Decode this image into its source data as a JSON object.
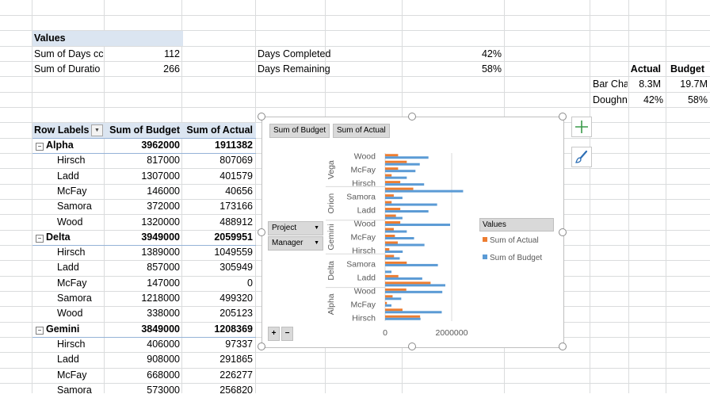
{
  "values_table": {
    "header": "Values",
    "rows": [
      {
        "label": "Sum of Days cc",
        "value": "112"
      },
      {
        "label": "Sum of Duratio",
        "value": "266"
      }
    ]
  },
  "days_table": {
    "rows": [
      {
        "label": "Days Completed",
        "value": "42%"
      },
      {
        "label": "Days Remaining",
        "value": "58%"
      }
    ]
  },
  "summary_table": {
    "headers": [
      "Actual",
      "Budget"
    ],
    "rows": [
      {
        "label": "Bar Cha",
        "actual": "8.3M",
        "budget": "19.7M"
      },
      {
        "label": "Doughn",
        "actual": "42%",
        "budget": "58%"
      }
    ]
  },
  "pivot": {
    "headers": {
      "row_labels": "Row Labels",
      "budget": "Sum of Budget",
      "actual": "Sum of Actual"
    },
    "rows": [
      {
        "type": "group",
        "label": "Alpha",
        "budget": "3962000",
        "actual": "1911382"
      },
      {
        "type": "item",
        "label": "Hirsch",
        "budget": "817000",
        "actual": "807069"
      },
      {
        "type": "item",
        "label": "Ladd",
        "budget": "1307000",
        "actual": "401579"
      },
      {
        "type": "item",
        "label": "McFay",
        "budget": "146000",
        "actual": "40656"
      },
      {
        "type": "item",
        "label": "Samora",
        "budget": "372000",
        "actual": "173166"
      },
      {
        "type": "item",
        "label": "Wood",
        "budget": "1320000",
        "actual": "488912"
      },
      {
        "type": "group",
        "label": "Delta",
        "budget": "3949000",
        "actual": "2059951"
      },
      {
        "type": "item",
        "label": "Hirsch",
        "budget": "1389000",
        "actual": "1049559"
      },
      {
        "type": "item",
        "label": "Ladd",
        "budget": "857000",
        "actual": "305949"
      },
      {
        "type": "item",
        "label": "McFay",
        "budget": "147000",
        "actual": "0"
      },
      {
        "type": "item",
        "label": "Samora",
        "budget": "1218000",
        "actual": "499320"
      },
      {
        "type": "item",
        "label": "Wood",
        "budget": "338000",
        "actual": "205123"
      },
      {
        "type": "group",
        "label": "Gemini",
        "budget": "3849000",
        "actual": "1208369"
      },
      {
        "type": "item",
        "label": "Hirsch",
        "budget": "406000",
        "actual": "97337"
      },
      {
        "type": "item",
        "label": "Ladd",
        "budget": "908000",
        "actual": "291865"
      },
      {
        "type": "item",
        "label": "McFay",
        "budget": "668000",
        "actual": "226277"
      },
      {
        "type": "item",
        "label": "Samora",
        "budget": "573000",
        "actual": "256820"
      }
    ]
  },
  "chart_ui": {
    "field_buttons": [
      "Sum of Budget",
      "Sum of Actual"
    ],
    "axis_buttons": [
      "Project",
      "Manager"
    ],
    "legend_title": "Values",
    "plus_label": "+",
    "minus_label": "−",
    "icons": {
      "add": "plus-icon",
      "style": "brush-icon"
    }
  },
  "chart_data": {
    "type": "bar",
    "orientation": "horizontal",
    "groups": [
      {
        "name": "Vega",
        "categories": [
          {
            "name": "Wood",
            "budget": 1000000,
            "actual": 300000
          },
          {
            "name": "",
            "budget": 800000,
            "actual": 500000
          },
          {
            "name": "McFay",
            "budget": 700000,
            "actual": 300000
          },
          {
            "name": "",
            "budget": 500000,
            "actual": 150000
          },
          {
            "name": "Hirsch",
            "budget": 900000,
            "actual": 350000
          }
        ]
      },
      {
        "name": "Orion",
        "categories": [
          {
            "name": "",
            "budget": 1800000,
            "actual": 650000
          },
          {
            "name": "Samora",
            "budget": 400000,
            "actual": 200000
          },
          {
            "name": "",
            "budget": 1200000,
            "actual": 150000
          },
          {
            "name": "Ladd",
            "budget": 1000000,
            "actual": 350000
          },
          {
            "name": "",
            "budget": 400000,
            "actual": 250000
          }
        ]
      },
      {
        "name": "Gemini",
        "categories": [
          {
            "name": "Wood",
            "budget": 1500000,
            "actual": 350000
          },
          {
            "name": "",
            "budget": 500000,
            "actual": 200000
          },
          {
            "name": "McFay",
            "budget": 668000,
            "actual": 226277
          },
          {
            "name": "",
            "budget": 908000,
            "actual": 291865
          },
          {
            "name": "Hirsch",
            "budget": 406000,
            "actual": 97337
          }
        ]
      },
      {
        "name": "Delta",
        "categories": [
          {
            "name": "",
            "budget": 338000,
            "actual": 205123
          },
          {
            "name": "Samora",
            "budget": 1218000,
            "actual": 499320
          },
          {
            "name": "",
            "budget": 147000,
            "actual": 0
          },
          {
            "name": "Ladd",
            "budget": 857000,
            "actual": 305949
          },
          {
            "name": "",
            "budget": 1389000,
            "actual": 1049559
          }
        ]
      },
      {
        "name": "Alpha",
        "categories": [
          {
            "name": "Wood",
            "budget": 1320000,
            "actual": 488912
          },
          {
            "name": "",
            "budget": 372000,
            "actual": 173166
          },
          {
            "name": "McFay",
            "budget": 146000,
            "actual": 40656
          },
          {
            "name": "",
            "budget": 1307000,
            "actual": 401579
          },
          {
            "name": "Hirsch",
            "budget": 817000,
            "actual": 807069
          }
        ]
      }
    ],
    "series": [
      {
        "name": "Sum of Actual",
        "key": "actual",
        "color": "#ed7d31"
      },
      {
        "name": "Sum of Budget",
        "key": "budget",
        "color": "#5b9bd5"
      }
    ],
    "x_ticks": [
      "0",
      "2000000"
    ],
    "xlim": [
      0,
      3200000
    ],
    "legend_position": "right",
    "grid": false
  }
}
